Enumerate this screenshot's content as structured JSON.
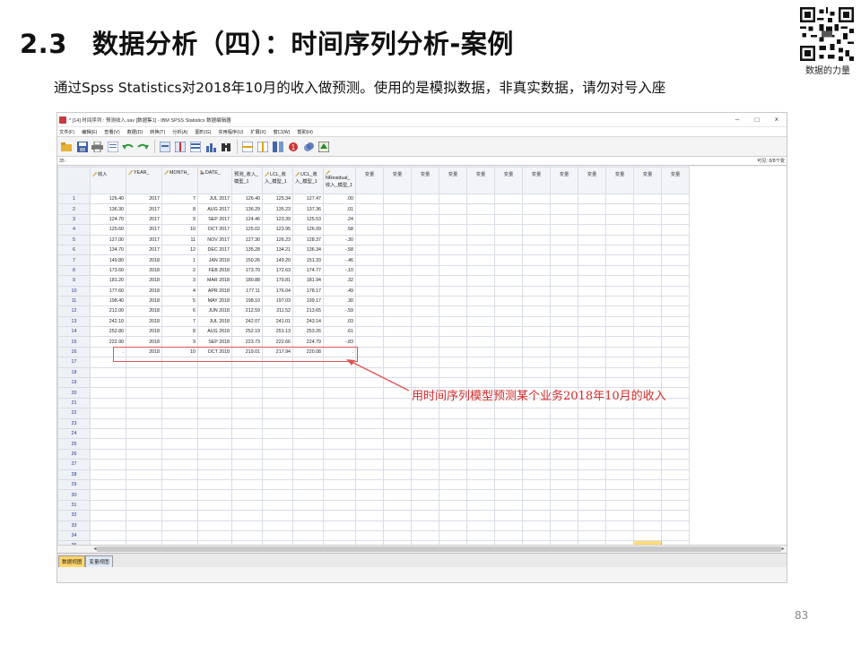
{
  "slide": {
    "section_num": "2.3",
    "title": "数据分析（四）：时间序列分析-案例",
    "subtitle": "通过Spss Statistics对2018年10月的收入做预测。使用的是模拟数据，非真实数据，请勿对号入座",
    "qr_caption": "数据的力量",
    "page_number": "83",
    "annotation": "用时间序列模型预测某个业务2018年10月的收入",
    "colors": {
      "annotation": "#d82a2a",
      "highlight": "#ffdf7a",
      "active_tab": "#ffd46a"
    }
  },
  "window": {
    "title": "* [14] 时间序列 : 预测收入.sav [数据集1] - IBM SPSS Statistics 数据编辑器",
    "controls": [
      "–",
      "□",
      "×"
    ],
    "menu": [
      "文件(F)",
      "编辑(E)",
      "查看(V)",
      "数据(D)",
      "转换(T)",
      "分析(A)",
      "图形(G)",
      "实用程序(U)",
      "扩展(X)",
      "窗口(W)",
      "帮助(H)"
    ],
    "toolbar_icons": [
      "open-icon",
      "save-icon",
      "print-icon",
      "dialog-recall-icon",
      "undo-icon",
      "redo-icon",
      "goto-case-icon",
      "goto-variable-icon",
      "variables-icon",
      "run-descriptives-icon",
      "find-icon",
      "insert-cases-icon",
      "insert-variable-icon",
      "split-file-icon",
      "weight-cases-icon",
      "select-cases-icon",
      "value-labels-icon",
      "use-sets-icon"
    ],
    "cell_ref": "35 :",
    "visible_vars": "可见: 8/8个变",
    "columns": [
      {
        "label": "收入",
        "icon": "scale"
      },
      {
        "label": "YEAR_",
        "icon": "scale"
      },
      {
        "label": "MONTH_",
        "icon": "scale"
      },
      {
        "label": "DATE_",
        "icon": "nominal"
      },
      {
        "label": "预测_收入_模型_1",
        "icon": "none"
      },
      {
        "label": "LCL_收入_模型_1",
        "icon": "scale"
      },
      {
        "label": "UCL_收入_模型_1",
        "icon": "scale"
      },
      {
        "label": "NResidual_收入_模型_1",
        "icon": "scale"
      }
    ],
    "empty_col_label": "变量",
    "rows": [
      [
        "126.40",
        "2017",
        "7",
        "JUL 2017",
        "126.40",
        "125.34",
        "127.47",
        ".00"
      ],
      [
        "136.30",
        "2017",
        "8",
        "AUG 2017",
        "136.29",
        "135.23",
        "137.36",
        ".01"
      ],
      [
        "124.70",
        "2017",
        "9",
        "SEP 2017",
        "124.46",
        "123.39",
        "125.53",
        ".24"
      ],
      [
        "125.60",
        "2017",
        "10",
        "OCT 2017",
        "125.02",
        "123.95",
        "126.09",
        ".58"
      ],
      [
        "127.00",
        "2017",
        "11",
        "NOV 2017",
        "127.30",
        "126.23",
        "128.37",
        "-.30"
      ],
      [
        "134.70",
        "2017",
        "12",
        "DEC 2017",
        "135.28",
        "134.21",
        "136.34",
        "-.58"
      ],
      [
        "149.80",
        "2018",
        "1",
        "JAN 2018",
        "150.26",
        "149.20",
        "151.33",
        "-.46"
      ],
      [
        "173.60",
        "2018",
        "2",
        "FEB 2018",
        "173.70",
        "172.63",
        "174.77",
        "-.10"
      ],
      [
        "181.20",
        "2018",
        "3",
        "MAR 2018",
        "180.88",
        "179.81",
        "181.94",
        ".32"
      ],
      [
        "177.60",
        "2018",
        "4",
        "APR 2018",
        "177.11",
        "176.04",
        "178.17",
        ".49"
      ],
      [
        "198.40",
        "2018",
        "5",
        "MAY 2018",
        "198.10",
        "197.03",
        "199.17",
        ".30"
      ],
      [
        "212.00",
        "2018",
        "6",
        "JUN 2018",
        "212.59",
        "211.52",
        "213.65",
        "-.59"
      ],
      [
        "242.10",
        "2018",
        "7",
        "JUL 2018",
        "242.07",
        "241.01",
        "243.14",
        ".03"
      ],
      [
        "252.80",
        "2018",
        "8",
        "AUG 2018",
        "252.19",
        "251.13",
        "253.26",
        ".61"
      ],
      [
        "222.90",
        "2018",
        "9",
        "SEP 2018",
        "223.73",
        "222.66",
        "224.79",
        "-.83"
      ],
      [
        ".",
        "2018",
        "10",
        "OCT 2018",
        "219.01",
        "217.94",
        "220.08",
        "."
      ]
    ],
    "total_rows": 36,
    "tabs": [
      "数据视图",
      "变量视图"
    ]
  }
}
